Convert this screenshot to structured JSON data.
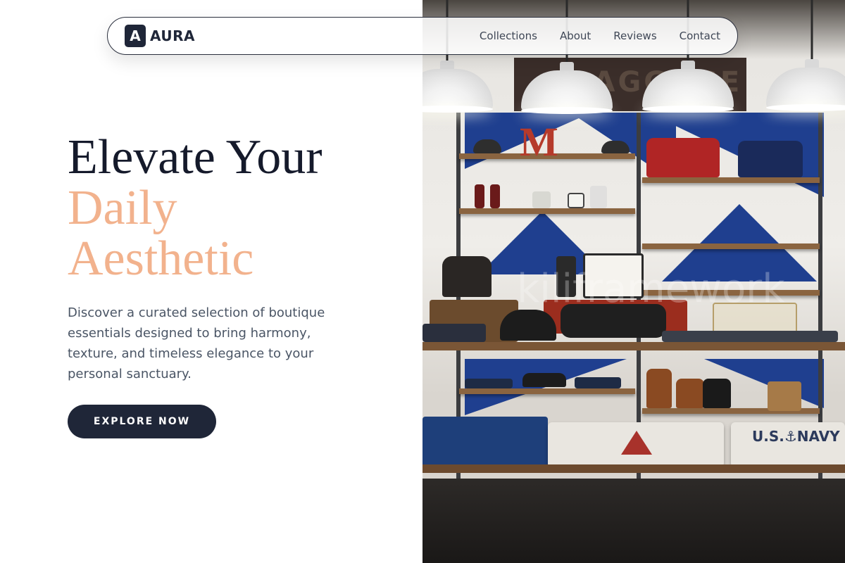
{
  "brand": {
    "mark": "A",
    "name": "AURA"
  },
  "nav": {
    "links": [
      "Collections",
      "About",
      "Reviews",
      "Contact"
    ]
  },
  "hero": {
    "headline_line1": "Elevate Your",
    "headline_line2": "Daily",
    "headline_line3": "Aesthetic",
    "description": "Discover a curated selection of boutique essentials designed to bring harmony, texture, and timeless elegance to your personal sanctuary.",
    "cta_label": "EXPLORE NOW"
  },
  "photo": {
    "sign_text": "BAGGAGE",
    "letter": "M",
    "tee_text": "U.S.⚓NAVY",
    "watermark": "kiliframework"
  },
  "colors": {
    "primary": "#1f2638",
    "accent": "#f2b28d",
    "headline": "#151a2b",
    "body_text": "#4a5565",
    "wall_blue": "#1f3f8f"
  }
}
